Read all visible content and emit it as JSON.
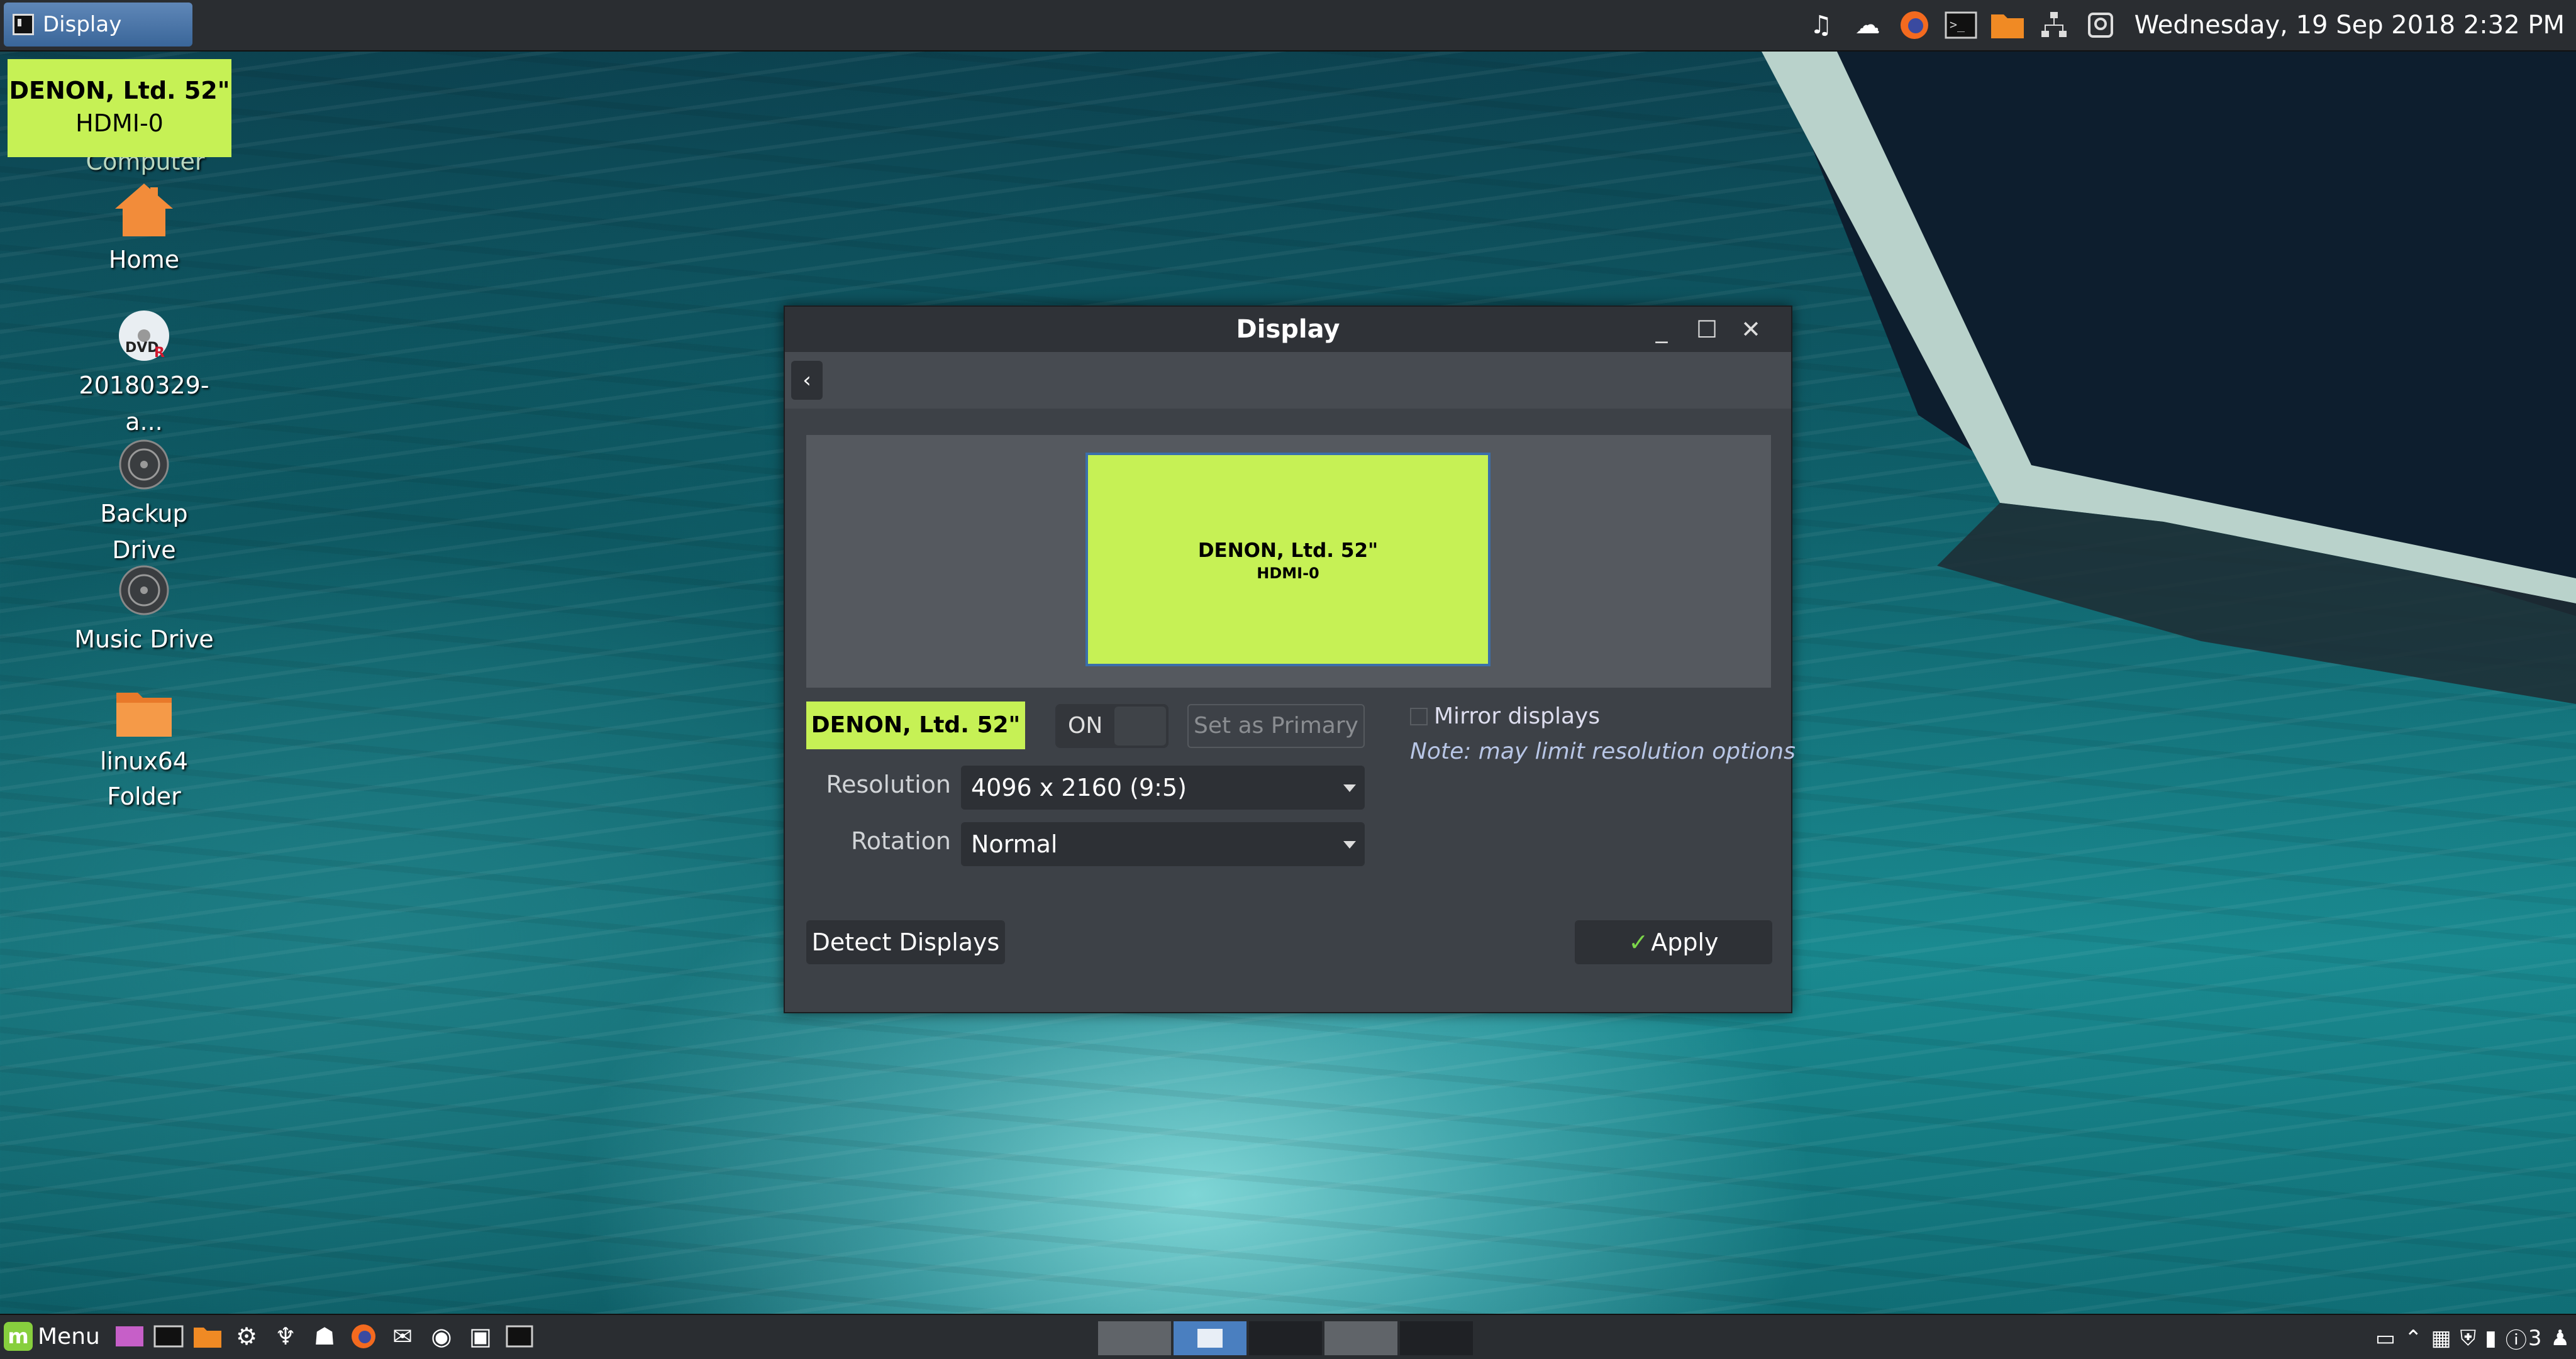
{
  "top_panel": {
    "active_window": "Display",
    "clock": "Wednesday, 19 Sep 2018  2:32 PM",
    "tray_icons": [
      "music-icon",
      "weather-icon",
      "firefox-icon",
      "terminal-icon",
      "folder-icon",
      "network-icon",
      "accessibility-icon"
    ]
  },
  "osd": {
    "line1": "DENON, Ltd. 52\"",
    "line2": "HDMI-0"
  },
  "desktop": {
    "icons": [
      {
        "label": "Computer",
        "icon": "computer-icon"
      },
      {
        "label": "Home",
        "icon": "home-icon"
      },
      {
        "label": "20180329-a...",
        "icon": "dvd-icon"
      },
      {
        "label": "Backup Drive",
        "icon": "drive-icon"
      },
      {
        "label": "Music Drive",
        "icon": "drive-icon"
      },
      {
        "label": "linux64",
        "label2": "Folder",
        "icon": "folder-icon"
      }
    ]
  },
  "window": {
    "title": "Display",
    "back_icon": "chevron-left-icon",
    "preview": {
      "name": "DENON, Ltd. 52\"",
      "port": "HDMI-0"
    },
    "output_name": "DENON, Ltd. 52\"",
    "toggle_label": "ON",
    "set_primary_label": "Set as Primary",
    "mirror_label": "Mirror displays",
    "mirror_checked": false,
    "note": "Note: may limit resolution options",
    "resolution_label": "Resolution",
    "resolution_value": "4096 x 2160 (9:5)",
    "rotation_label": "Rotation",
    "rotation_value": "Normal",
    "detect_label": "Detect Displays",
    "apply_label": "Apply",
    "accent": "#c6f155"
  },
  "bottom_panel": {
    "menu_label": "Menu",
    "launchers": [
      "show-desktop-icon",
      "terminal-icon",
      "files-icon",
      "settings-icon",
      "bleachbit-icon",
      "games-icon",
      "firefox-icon",
      "thunderbird-icon",
      "media-icon",
      "screenshot-icon",
      "terminal-icon"
    ],
    "workspaces": 5,
    "active_workspace": 2,
    "tray_text": "3"
  }
}
